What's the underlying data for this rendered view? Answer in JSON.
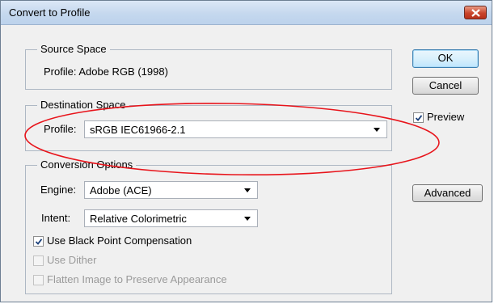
{
  "window": {
    "title": "Convert to Profile"
  },
  "source_space": {
    "legend": "Source Space",
    "profile_text": "Profile: Adobe RGB (1998)"
  },
  "destination_space": {
    "legend": "Destination Space",
    "profile_label": "Profile:",
    "profile_value": "sRGB IEC61966-2.1"
  },
  "conversion_options": {
    "legend": "Conversion Options",
    "engine_label": "Engine:",
    "engine_value": "Adobe (ACE)",
    "intent_label": "Intent:",
    "intent_value": "Relative Colorimetric",
    "black_point": {
      "label": "Use Black Point Compensation",
      "checked": true
    },
    "dither": {
      "label": "Use Dither",
      "checked": false,
      "disabled": true
    },
    "flatten": {
      "label": "Flatten Image to Preserve Appearance",
      "checked": false,
      "disabled": true
    }
  },
  "buttons": {
    "ok": "OK",
    "cancel": "Cancel",
    "advanced": "Advanced"
  },
  "preview": {
    "label": "Preview",
    "checked": true
  },
  "colors": {
    "annotation": "#e8141b",
    "check": "#1a3f7a"
  }
}
